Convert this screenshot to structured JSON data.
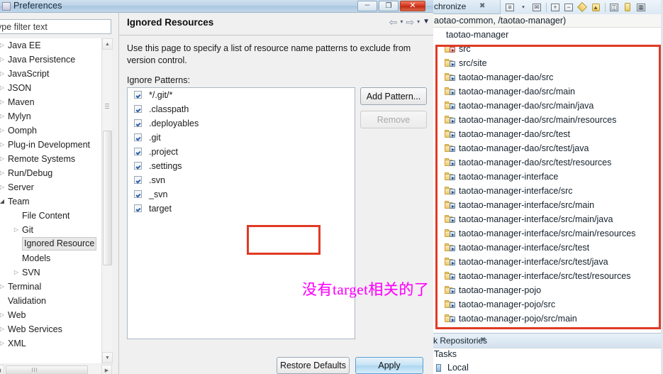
{
  "dialog": {
    "title": "Preferences",
    "icon": "preferences-window-icon",
    "window_controls": {
      "minimize": "–",
      "maximize": "❐",
      "close": "✕"
    },
    "filter": {
      "value": "ype filter text",
      "placeholder": "type filter text"
    },
    "tree": [
      {
        "label": "Java EE",
        "indent": 1,
        "arrow": "collapsed",
        "selected": false
      },
      {
        "label": "Java Persistence",
        "indent": 1,
        "arrow": "collapsed",
        "selected": false
      },
      {
        "label": "JavaScript",
        "indent": 1,
        "arrow": "collapsed",
        "selected": false
      },
      {
        "label": "JSON",
        "indent": 1,
        "arrow": "collapsed",
        "selected": false
      },
      {
        "label": "Maven",
        "indent": 1,
        "arrow": "collapsed",
        "selected": false
      },
      {
        "label": "Mylyn",
        "indent": 1,
        "arrow": "collapsed",
        "selected": false
      },
      {
        "label": "Oomph",
        "indent": 1,
        "arrow": "collapsed",
        "selected": false
      },
      {
        "label": "Plug-in Development",
        "indent": 1,
        "arrow": "collapsed",
        "selected": false
      },
      {
        "label": "Remote Systems",
        "indent": 1,
        "arrow": "collapsed",
        "selected": false
      },
      {
        "label": "Run/Debug",
        "indent": 1,
        "arrow": "collapsed",
        "selected": false
      },
      {
        "label": "Server",
        "indent": 1,
        "arrow": "collapsed",
        "selected": false
      },
      {
        "label": "Team",
        "indent": 1,
        "arrow": "expanded",
        "selected": false
      },
      {
        "label": "File Content",
        "indent": 2,
        "arrow": "none",
        "selected": false
      },
      {
        "label": "Git",
        "indent": 2,
        "arrow": "collapsed",
        "selected": false
      },
      {
        "label": "Ignored Resource",
        "indent": 2,
        "arrow": "none",
        "selected": true
      },
      {
        "label": "Models",
        "indent": 2,
        "arrow": "none",
        "selected": false
      },
      {
        "label": "SVN",
        "indent": 2,
        "arrow": "collapsed",
        "selected": false
      },
      {
        "label": "Terminal",
        "indent": 1,
        "arrow": "collapsed",
        "selected": false
      },
      {
        "label": "Validation",
        "indent": 1,
        "arrow": "none",
        "selected": false
      },
      {
        "label": "Web",
        "indent": 1,
        "arrow": "collapsed",
        "selected": false
      },
      {
        "label": "Web Services",
        "indent": 1,
        "arrow": "collapsed",
        "selected": false
      },
      {
        "label": "XML",
        "indent": 1,
        "arrow": "collapsed",
        "selected": false
      }
    ],
    "page": {
      "title": "Ignored Resources",
      "description": "Use this page to specify a list of resource name patterns to exclude from version control.",
      "patterns_label": "Ignore Patterns:",
      "patterns": [
        {
          "label": "*/.git/*",
          "checked": true,
          "highlighted": false
        },
        {
          "label": ".classpath",
          "checked": true,
          "highlighted": false
        },
        {
          "label": ".deployables",
          "checked": true,
          "highlighted": false
        },
        {
          "label": ".git",
          "checked": true,
          "highlighted": false
        },
        {
          "label": ".project",
          "checked": true,
          "highlighted": false
        },
        {
          "label": ".settings",
          "checked": true,
          "highlighted": false
        },
        {
          "label": ".svn",
          "checked": true,
          "highlighted": false
        },
        {
          "label": "_svn",
          "checked": true,
          "highlighted": false
        },
        {
          "label": "target",
          "checked": true,
          "highlighted": true
        }
      ],
      "add_pattern_button": "Add Pattern...",
      "remove_button": "Remove",
      "restore_defaults_button": "Restore Defaults",
      "apply_button": "Apply",
      "annotation": "没有target相关的了"
    },
    "nav": {
      "back_icon": "arrow-left-icon",
      "back_caret": "▾",
      "forward_icon": "arrow-right-icon",
      "forward_caret": "▾",
      "menu_caret": "▼"
    },
    "scrollbars": {
      "up_arrow": "▲",
      "down_arrow": "▼",
      "left_arrow": "◀",
      "right_arrow": "▶"
    }
  },
  "eclipse": {
    "top_tab": {
      "label": "chronize",
      "close_icon": "✖"
    },
    "toolbar": [
      {
        "name": "collapse-all-icon",
        "glyph": ""
      },
      {
        "name": "toolbar-dropdown-caret",
        "glyph": "▾"
      },
      {
        "name": "open-mail-icon",
        "glyph": ""
      },
      {
        "name": "expand-all-icon",
        "glyph": "+"
      },
      {
        "name": "collapse-icon",
        "glyph": "−"
      },
      {
        "name": "incoming-change-icon",
        "glyph": ""
      },
      {
        "name": "outgoing-change-icon",
        "glyph": "↑"
      },
      {
        "name": "layout-icon",
        "glyph": ""
      },
      {
        "name": "pin-icon",
        "glyph": ""
      },
      {
        "name": "view-menu-icon",
        "glyph": ""
      }
    ],
    "breadcrumb": "aotao-common, /taotao-manager)",
    "tree_root": "taotao-manager",
    "tree_items": [
      {
        "label": "src",
        "first": true
      },
      {
        "label": "src/site",
        "first": false
      },
      {
        "label": "taotao-manager-dao/src",
        "first": false
      },
      {
        "label": "taotao-manager-dao/src/main",
        "first": false
      },
      {
        "label": "taotao-manager-dao/src/main/java",
        "first": false
      },
      {
        "label": "taotao-manager-dao/src/main/resources",
        "first": false
      },
      {
        "label": "taotao-manager-dao/src/test",
        "first": false
      },
      {
        "label": "taotao-manager-dao/src/test/java",
        "first": false
      },
      {
        "label": "taotao-manager-dao/src/test/resources",
        "first": false
      },
      {
        "label": "taotao-manager-interface",
        "first": false
      },
      {
        "label": "taotao-manager-interface/src",
        "first": false
      },
      {
        "label": "taotao-manager-interface/src/main",
        "first": false
      },
      {
        "label": "taotao-manager-interface/src/main/java",
        "first": false
      },
      {
        "label": "taotao-manager-interface/src/main/resources",
        "first": false
      },
      {
        "label": "taotao-manager-interface/src/test",
        "first": false
      },
      {
        "label": "taotao-manager-interface/src/test/java",
        "first": false
      },
      {
        "label": "taotao-manager-interface/src/test/resources",
        "first": false
      },
      {
        "label": "taotao-manager-pojo",
        "first": false
      },
      {
        "label": "taotao-manager-pojo/src",
        "first": false
      },
      {
        "label": "taotao-manager-pojo/src/main",
        "first": false
      }
    ],
    "bottom_tab": {
      "label": "k Repositories",
      "close_icon": "✖"
    },
    "tasks_label": "Tasks",
    "local_label": "Local"
  },
  "colors": {
    "highlight_red": "#e03a24",
    "annotation_magenta": "#ff00ff",
    "dialog_bg": "#f0f0f0",
    "apply_blue": "#aed7f0"
  }
}
